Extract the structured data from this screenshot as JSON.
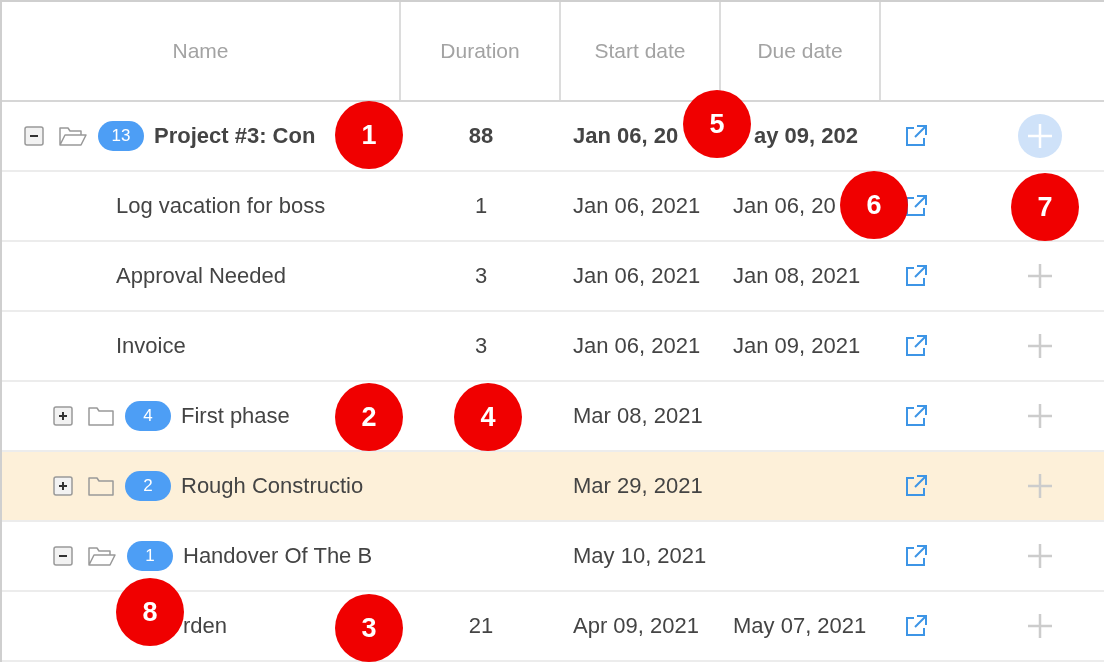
{
  "columns": [
    "Name",
    "Duration",
    "Start date",
    "Due date"
  ],
  "rows": [
    {
      "kind": "group",
      "name": "Project #3: Con",
      "count": "13",
      "duration": "88",
      "start": "Jan 06, 20",
      "due": "ay 09, 202",
      "expanded": true,
      "selected": false,
      "add_active": true,
      "children": [
        {
          "kind": "task",
          "name": "Log vacation for boss",
          "duration": "1",
          "start": "Jan 06, 2021",
          "due": "Jan 06, 20",
          "selected": false,
          "add_active": false
        },
        {
          "kind": "task",
          "name": "Approval Needed",
          "duration": "3",
          "start": "Jan 06, 2021",
          "due": "Jan 08, 2021",
          "selected": false,
          "add_active": false
        },
        {
          "kind": "task",
          "name": "Invoice",
          "duration": "3",
          "start": "Jan 06, 2021",
          "due": "Jan 09, 2021",
          "selected": false,
          "add_active": false
        },
        {
          "kind": "group",
          "name": "First phase",
          "count": "4",
          "start": "Mar 08, 2021",
          "expanded": false,
          "selected": false,
          "add_active": false
        },
        {
          "kind": "group",
          "name": "Rough Constructio",
          "count": "2",
          "start": "Mar 29, 2021",
          "expanded": false,
          "selected": true,
          "add_active": false
        },
        {
          "kind": "group",
          "name": "Handover Of The B",
          "count": "1",
          "start": "May 10, 2021",
          "expanded": true,
          "selected": false,
          "add_active": false,
          "children": [
            {
              "kind": "task",
              "name": "rden",
              "duration": "21",
              "start": "Apr 09, 2021",
              "due": "May 07, 2021",
              "selected": false,
              "add_active": false
            }
          ]
        }
      ]
    }
  ],
  "callouts": [
    {
      "label": "5"
    },
    {
      "label": "1"
    },
    {
      "label": "6"
    },
    {
      "label": "7"
    },
    {
      "label": "2"
    },
    {
      "label": "4"
    },
    {
      "label": "8"
    },
    {
      "label": "3"
    }
  ]
}
